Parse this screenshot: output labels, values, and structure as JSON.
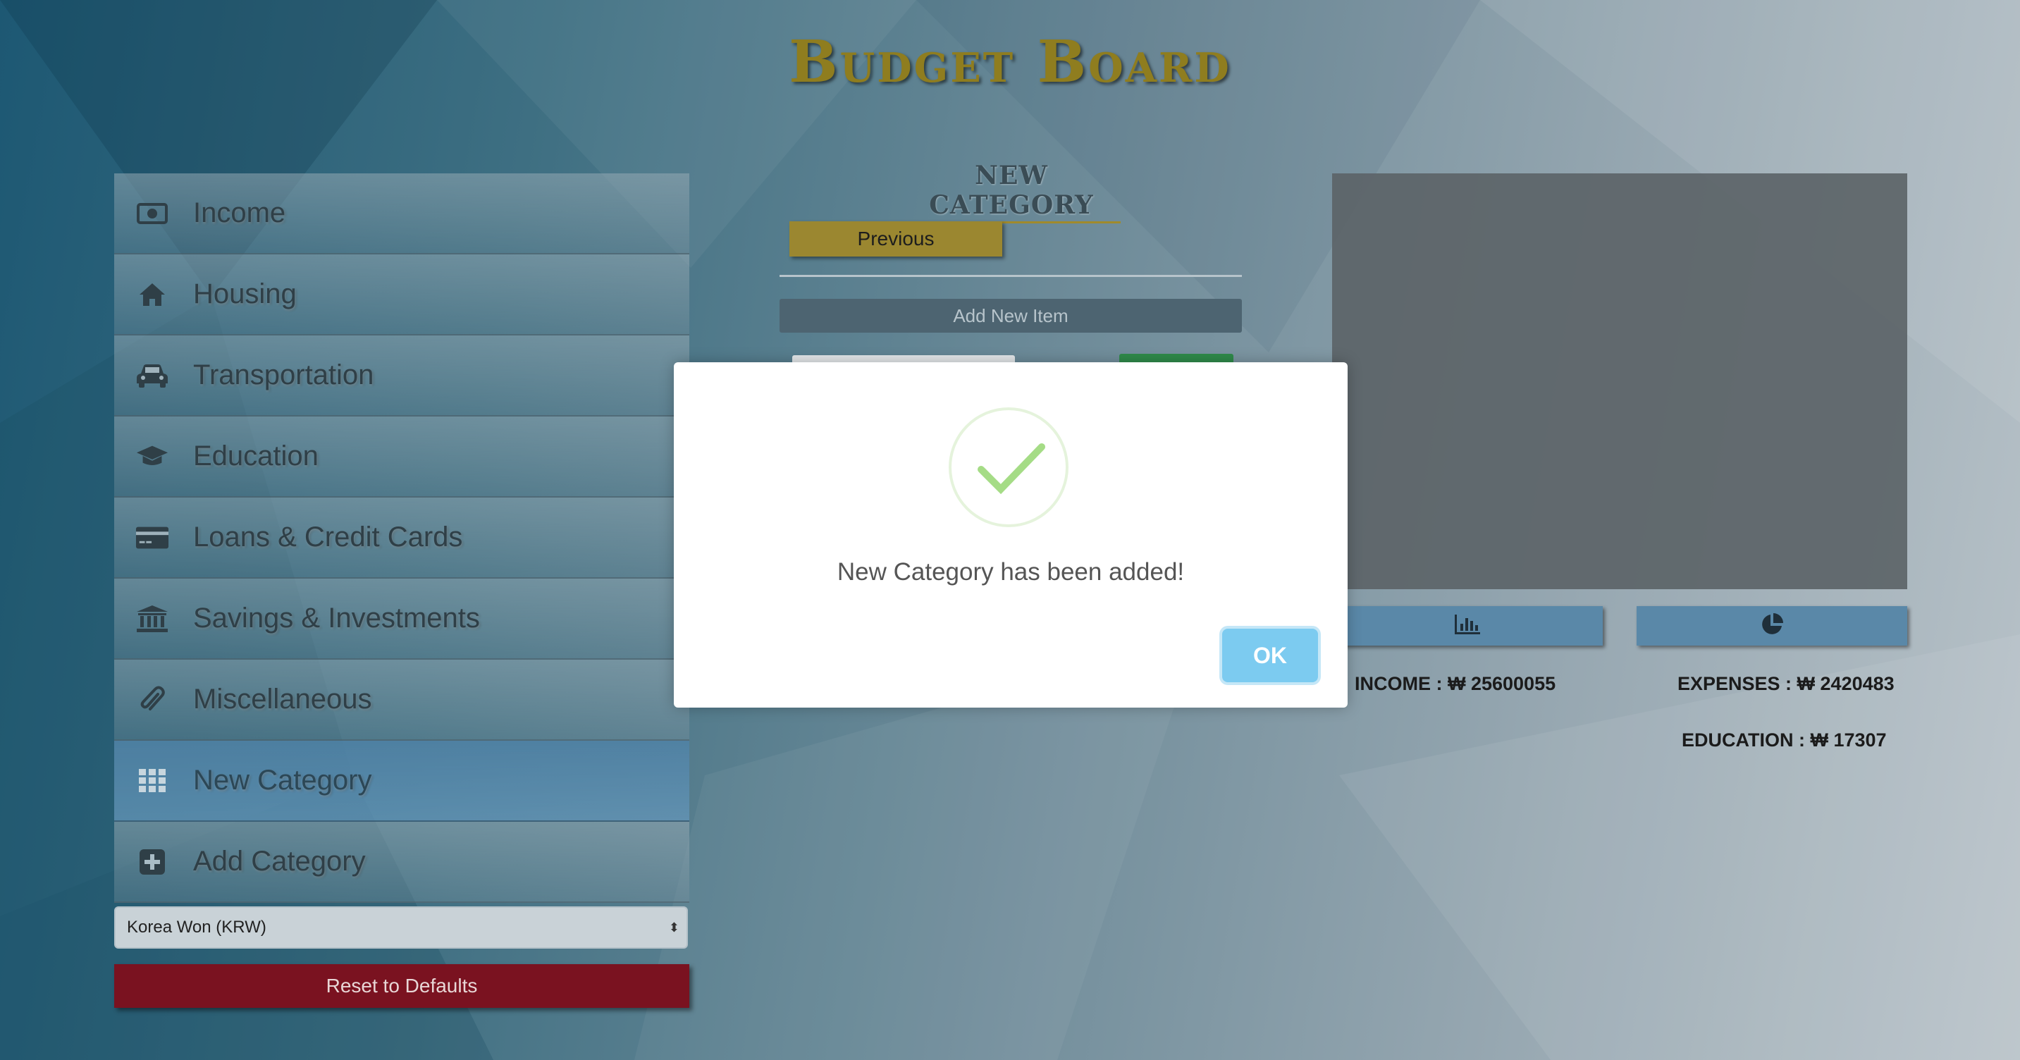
{
  "app": {
    "title": "Budget Board"
  },
  "sidebar": {
    "items": [
      {
        "label": "Income",
        "icon": "money-icon"
      },
      {
        "label": "Housing",
        "icon": "home-icon"
      },
      {
        "label": "Transportation",
        "icon": "car-icon"
      },
      {
        "label": "Education",
        "icon": "graduation-cap-icon"
      },
      {
        "label": "Loans & Credit Cards",
        "icon": "credit-card-icon"
      },
      {
        "label": "Savings & Investments",
        "icon": "bank-icon"
      },
      {
        "label": "Miscellaneous",
        "icon": "paperclip-icon"
      },
      {
        "label": "New Category",
        "icon": "grid-icon",
        "active": true
      },
      {
        "label": "Add Category",
        "icon": "plus-square-icon"
      }
    ],
    "currency": {
      "selected": "Korea Won (KRW)"
    },
    "reset_label": "Reset to Defaults"
  },
  "main": {
    "section_title": "NEW CATEGORY",
    "previous_label": "Previous",
    "add_new_item_label": "Add New Item"
  },
  "summary": {
    "income": "INCOME : ₩ 25600055",
    "expenses": "EXPENSES : ₩ 2420483",
    "education": "EDUCATION : ₩ 17307",
    "bar_chart_icon": "bar-chart-icon",
    "pie_chart_icon": "pie-chart-icon"
  },
  "modal": {
    "message": "New Category has been added!",
    "ok_label": "OK",
    "icon": "success-check-icon"
  },
  "colors": {
    "accent_gold": "#9b8730",
    "reset_red": "#7a1220",
    "ok_blue": "#7ccbf0",
    "check_green": "#a5dc86"
  }
}
